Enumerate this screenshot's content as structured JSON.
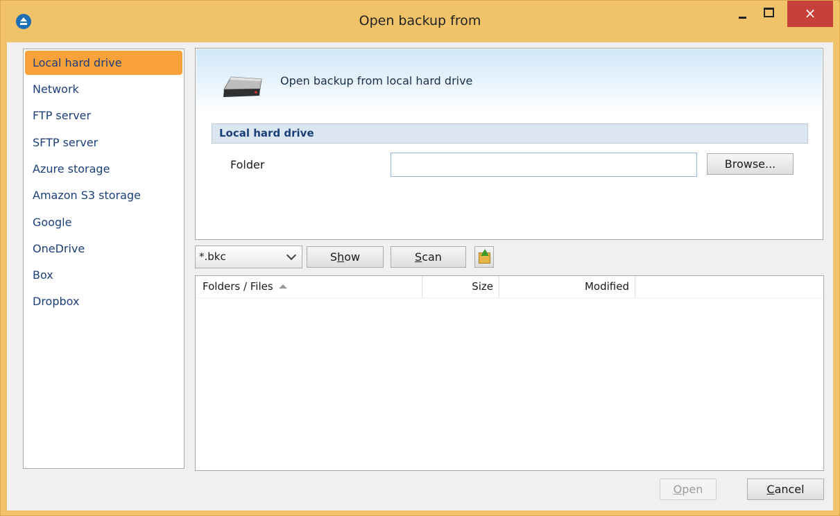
{
  "window": {
    "title": "Open backup from",
    "close_label": "×"
  },
  "sidebar": {
    "items": [
      {
        "label": "Local hard drive",
        "active": true
      },
      {
        "label": "Network"
      },
      {
        "label": "FTP server"
      },
      {
        "label": "SFTP server"
      },
      {
        "label": "Azure storage"
      },
      {
        "label": "Amazon S3 storage"
      },
      {
        "label": "Google"
      },
      {
        "label": "OneDrive"
      },
      {
        "label": "Box"
      },
      {
        "label": "Dropbox"
      }
    ]
  },
  "panel": {
    "heading": "Open backup from local hard drive",
    "section_title": "Local hard drive",
    "folder_label": "Folder",
    "folder_value": "",
    "browse_label": "Browse..."
  },
  "toolbar": {
    "filter_value": "*.bkc",
    "show_prefix": "S",
    "show_access": "h",
    "show_suffix": "ow",
    "scan_access": "S",
    "scan_suffix": "can"
  },
  "files": {
    "columns": [
      "Folders / Files",
      "Size",
      "Modified"
    ],
    "rows": []
  },
  "footer": {
    "open_access": "O",
    "open_suffix": "pen",
    "cancel_access": "C",
    "cancel_suffix": "ancel"
  },
  "colors": {
    "titlebar": "#f0c36b",
    "active_nav": "#f9a13a",
    "close_button": "#c7413a",
    "nav_text": "#1c3f7a"
  }
}
